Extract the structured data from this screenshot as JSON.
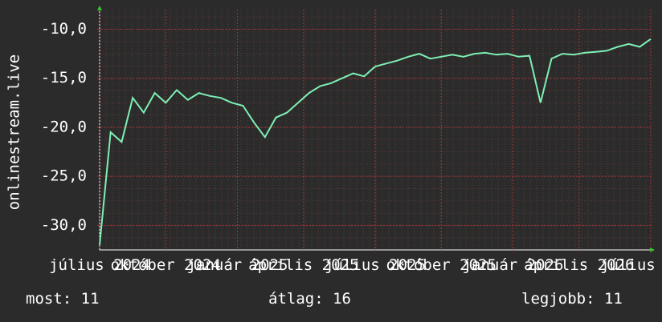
{
  "chart_data": {
    "type": "line",
    "title": "",
    "ylabel": "onlinestream.live",
    "xlabel": "",
    "ylim": [
      -32.5,
      -8.0
    ],
    "yticks": [
      -30,
      -25,
      -20,
      -15,
      -10
    ],
    "ytick_labels": [
      "-30,0",
      "-25,0",
      "-20,0",
      "-15,0",
      "-10,0"
    ],
    "xtick_labels": [
      {
        "t": 0.0,
        "label": "július 2024"
      },
      {
        "t": 0.12,
        "label": "október 2024"
      },
      {
        "t": 0.25,
        "label": "január 2025"
      },
      {
        "t": 0.37,
        "label": "április 2025"
      },
      {
        "t": 0.5,
        "label": "július 2025"
      },
      {
        "t": 0.62,
        "label": "október 2025"
      },
      {
        "t": 0.75,
        "label": "január 2026"
      },
      {
        "t": 0.87,
        "label": "április 2026"
      },
      {
        "t": 1.0,
        "label": "július 2026"
      }
    ],
    "grid": true,
    "line_color": "#7df0b4",
    "series": [
      {
        "name": "",
        "t": [
          0,
          0.02,
          0.04,
          0.06,
          0.08,
          0.1,
          0.12,
          0.14,
          0.16,
          0.18,
          0.2,
          0.22,
          0.24,
          0.26,
          0.28,
          0.3,
          0.32,
          0.34,
          0.36,
          0.38,
          0.4,
          0.42,
          0.44,
          0.46,
          0.48,
          0.5,
          0.52,
          0.54,
          0.56,
          0.58,
          0.6,
          0.62,
          0.64,
          0.66,
          0.68,
          0.7,
          0.72,
          0.74,
          0.76,
          0.78,
          0.8,
          0.82,
          0.84,
          0.86,
          0.88,
          0.9,
          0.92,
          0.94,
          0.96,
          0.98,
          1.0
        ],
        "values": [
          -32.0,
          -20.5,
          -21.5,
          -17.0,
          -18.5,
          -16.5,
          -17.5,
          -16.2,
          -17.2,
          -16.5,
          -16.8,
          -17.0,
          -17.5,
          -17.8,
          -19.5,
          -21.0,
          -19.0,
          -18.5,
          -17.5,
          -16.5,
          -15.8,
          -15.5,
          -15.0,
          -14.5,
          -14.8,
          -13.8,
          -13.5,
          -13.2,
          -12.8,
          -12.5,
          -13.0,
          -12.8,
          -12.6,
          -12.8,
          -12.5,
          -12.4,
          -12.6,
          -12.5,
          -12.8,
          -12.7,
          -17.5,
          -13.0,
          -12.5,
          -12.6,
          -12.4,
          -12.3,
          -12.2,
          -11.8,
          -11.5,
          -11.8,
          -11.0
        ]
      }
    ]
  },
  "footer": {
    "most": "most: 11",
    "atlag": "átlag: 16",
    "legjobb": "legjobb: 11"
  }
}
